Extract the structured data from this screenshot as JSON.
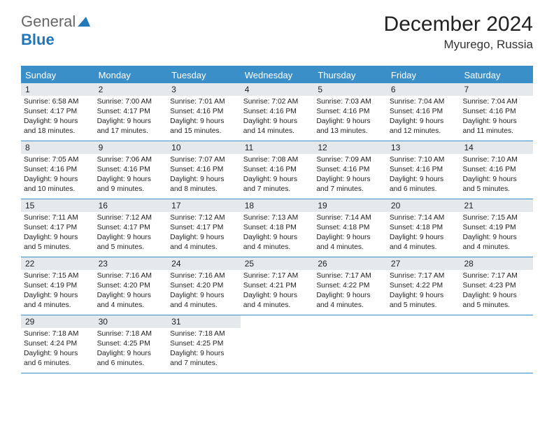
{
  "logo": {
    "text1": "General",
    "text2": "Blue"
  },
  "header": {
    "month_title": "December 2024",
    "location": "Myurego, Russia"
  },
  "weekdays": [
    "Sunday",
    "Monday",
    "Tuesday",
    "Wednesday",
    "Thursday",
    "Friday",
    "Saturday"
  ],
  "days": [
    {
      "num": "1",
      "sunrise": "Sunrise: 6:58 AM",
      "sunset": "Sunset: 4:17 PM",
      "daylight1": "Daylight: 9 hours",
      "daylight2": "and 18 minutes."
    },
    {
      "num": "2",
      "sunrise": "Sunrise: 7:00 AM",
      "sunset": "Sunset: 4:17 PM",
      "daylight1": "Daylight: 9 hours",
      "daylight2": "and 17 minutes."
    },
    {
      "num": "3",
      "sunrise": "Sunrise: 7:01 AM",
      "sunset": "Sunset: 4:16 PM",
      "daylight1": "Daylight: 9 hours",
      "daylight2": "and 15 minutes."
    },
    {
      "num": "4",
      "sunrise": "Sunrise: 7:02 AM",
      "sunset": "Sunset: 4:16 PM",
      "daylight1": "Daylight: 9 hours",
      "daylight2": "and 14 minutes."
    },
    {
      "num": "5",
      "sunrise": "Sunrise: 7:03 AM",
      "sunset": "Sunset: 4:16 PM",
      "daylight1": "Daylight: 9 hours",
      "daylight2": "and 13 minutes."
    },
    {
      "num": "6",
      "sunrise": "Sunrise: 7:04 AM",
      "sunset": "Sunset: 4:16 PM",
      "daylight1": "Daylight: 9 hours",
      "daylight2": "and 12 minutes."
    },
    {
      "num": "7",
      "sunrise": "Sunrise: 7:04 AM",
      "sunset": "Sunset: 4:16 PM",
      "daylight1": "Daylight: 9 hours",
      "daylight2": "and 11 minutes."
    },
    {
      "num": "8",
      "sunrise": "Sunrise: 7:05 AM",
      "sunset": "Sunset: 4:16 PM",
      "daylight1": "Daylight: 9 hours",
      "daylight2": "and 10 minutes."
    },
    {
      "num": "9",
      "sunrise": "Sunrise: 7:06 AM",
      "sunset": "Sunset: 4:16 PM",
      "daylight1": "Daylight: 9 hours",
      "daylight2": "and 9 minutes."
    },
    {
      "num": "10",
      "sunrise": "Sunrise: 7:07 AM",
      "sunset": "Sunset: 4:16 PM",
      "daylight1": "Daylight: 9 hours",
      "daylight2": "and 8 minutes."
    },
    {
      "num": "11",
      "sunrise": "Sunrise: 7:08 AM",
      "sunset": "Sunset: 4:16 PM",
      "daylight1": "Daylight: 9 hours",
      "daylight2": "and 7 minutes."
    },
    {
      "num": "12",
      "sunrise": "Sunrise: 7:09 AM",
      "sunset": "Sunset: 4:16 PM",
      "daylight1": "Daylight: 9 hours",
      "daylight2": "and 7 minutes."
    },
    {
      "num": "13",
      "sunrise": "Sunrise: 7:10 AM",
      "sunset": "Sunset: 4:16 PM",
      "daylight1": "Daylight: 9 hours",
      "daylight2": "and 6 minutes."
    },
    {
      "num": "14",
      "sunrise": "Sunrise: 7:10 AM",
      "sunset": "Sunset: 4:16 PM",
      "daylight1": "Daylight: 9 hours",
      "daylight2": "and 5 minutes."
    },
    {
      "num": "15",
      "sunrise": "Sunrise: 7:11 AM",
      "sunset": "Sunset: 4:17 PM",
      "daylight1": "Daylight: 9 hours",
      "daylight2": "and 5 minutes."
    },
    {
      "num": "16",
      "sunrise": "Sunrise: 7:12 AM",
      "sunset": "Sunset: 4:17 PM",
      "daylight1": "Daylight: 9 hours",
      "daylight2": "and 5 minutes."
    },
    {
      "num": "17",
      "sunrise": "Sunrise: 7:12 AM",
      "sunset": "Sunset: 4:17 PM",
      "daylight1": "Daylight: 9 hours",
      "daylight2": "and 4 minutes."
    },
    {
      "num": "18",
      "sunrise": "Sunrise: 7:13 AM",
      "sunset": "Sunset: 4:18 PM",
      "daylight1": "Daylight: 9 hours",
      "daylight2": "and 4 minutes."
    },
    {
      "num": "19",
      "sunrise": "Sunrise: 7:14 AM",
      "sunset": "Sunset: 4:18 PM",
      "daylight1": "Daylight: 9 hours",
      "daylight2": "and 4 minutes."
    },
    {
      "num": "20",
      "sunrise": "Sunrise: 7:14 AM",
      "sunset": "Sunset: 4:18 PM",
      "daylight1": "Daylight: 9 hours",
      "daylight2": "and 4 minutes."
    },
    {
      "num": "21",
      "sunrise": "Sunrise: 7:15 AM",
      "sunset": "Sunset: 4:19 PM",
      "daylight1": "Daylight: 9 hours",
      "daylight2": "and 4 minutes."
    },
    {
      "num": "22",
      "sunrise": "Sunrise: 7:15 AM",
      "sunset": "Sunset: 4:19 PM",
      "daylight1": "Daylight: 9 hours",
      "daylight2": "and 4 minutes."
    },
    {
      "num": "23",
      "sunrise": "Sunrise: 7:16 AM",
      "sunset": "Sunset: 4:20 PM",
      "daylight1": "Daylight: 9 hours",
      "daylight2": "and 4 minutes."
    },
    {
      "num": "24",
      "sunrise": "Sunrise: 7:16 AM",
      "sunset": "Sunset: 4:20 PM",
      "daylight1": "Daylight: 9 hours",
      "daylight2": "and 4 minutes."
    },
    {
      "num": "25",
      "sunrise": "Sunrise: 7:17 AM",
      "sunset": "Sunset: 4:21 PM",
      "daylight1": "Daylight: 9 hours",
      "daylight2": "and 4 minutes."
    },
    {
      "num": "26",
      "sunrise": "Sunrise: 7:17 AM",
      "sunset": "Sunset: 4:22 PM",
      "daylight1": "Daylight: 9 hours",
      "daylight2": "and 4 minutes."
    },
    {
      "num": "27",
      "sunrise": "Sunrise: 7:17 AM",
      "sunset": "Sunset: 4:22 PM",
      "daylight1": "Daylight: 9 hours",
      "daylight2": "and 5 minutes."
    },
    {
      "num": "28",
      "sunrise": "Sunrise: 7:17 AM",
      "sunset": "Sunset: 4:23 PM",
      "daylight1": "Daylight: 9 hours",
      "daylight2": "and 5 minutes."
    },
    {
      "num": "29",
      "sunrise": "Sunrise: 7:18 AM",
      "sunset": "Sunset: 4:24 PM",
      "daylight1": "Daylight: 9 hours",
      "daylight2": "and 6 minutes."
    },
    {
      "num": "30",
      "sunrise": "Sunrise: 7:18 AM",
      "sunset": "Sunset: 4:25 PM",
      "daylight1": "Daylight: 9 hours",
      "daylight2": "and 6 minutes."
    },
    {
      "num": "31",
      "sunrise": "Sunrise: 7:18 AM",
      "sunset": "Sunset: 4:25 PM",
      "daylight1": "Daylight: 9 hours",
      "daylight2": "and 7 minutes."
    }
  ]
}
